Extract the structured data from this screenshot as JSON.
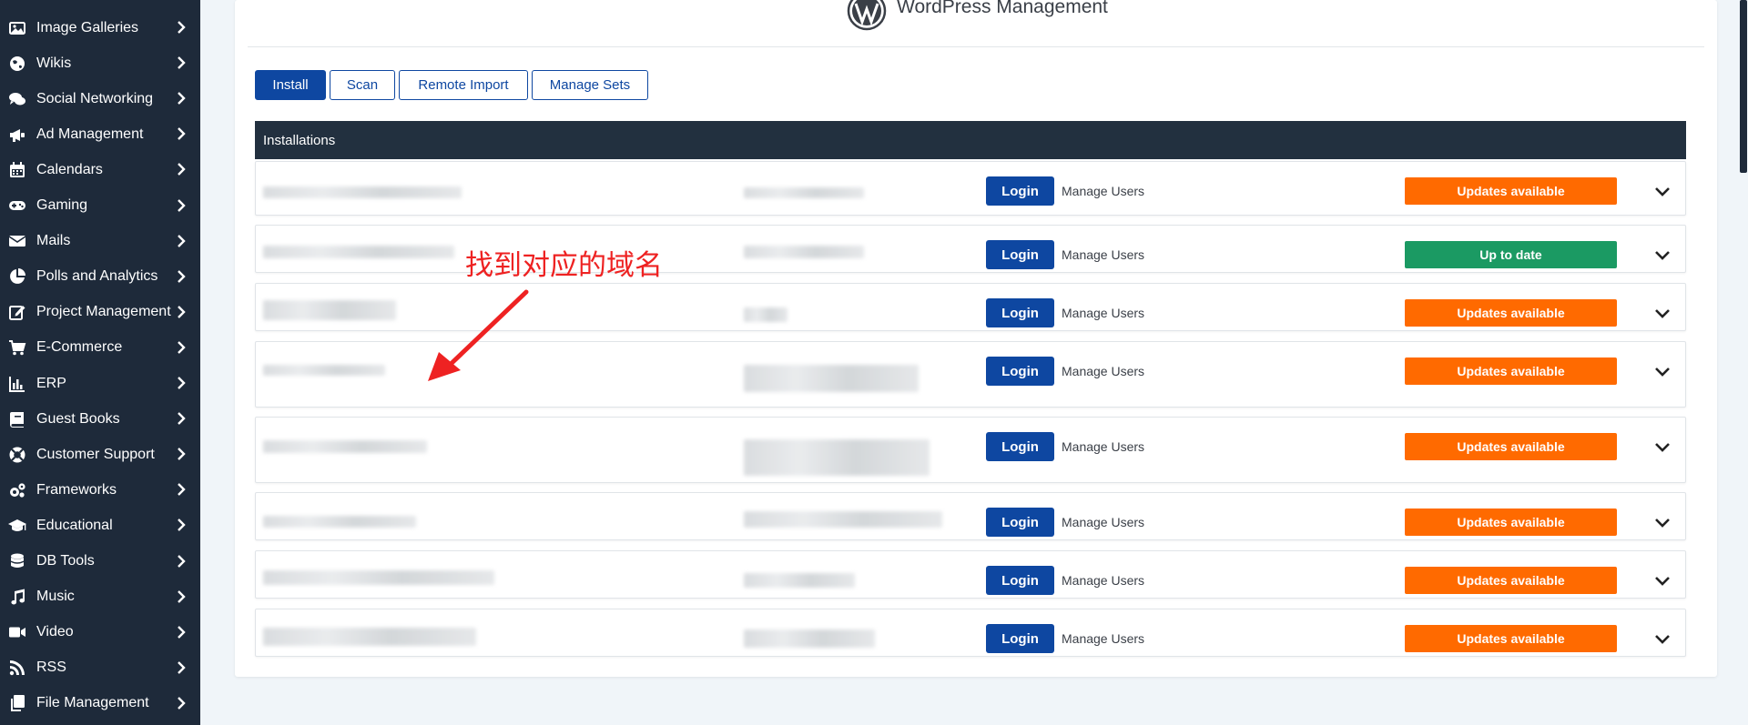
{
  "sidebar": {
    "items": [
      {
        "label": "Image Galleries",
        "icon": "image-icon"
      },
      {
        "label": "Wikis",
        "icon": "globe-icon"
      },
      {
        "label": "Social Networking",
        "icon": "chat-icon"
      },
      {
        "label": "Ad Management",
        "icon": "megaphone-icon"
      },
      {
        "label": "Calendars",
        "icon": "calendar-icon"
      },
      {
        "label": "Gaming",
        "icon": "gamepad-icon"
      },
      {
        "label": "Mails",
        "icon": "envelope-icon"
      },
      {
        "label": "Polls and Analytics",
        "icon": "pie-chart-icon"
      },
      {
        "label": "Project Management",
        "icon": "edit-icon"
      },
      {
        "label": "E-Commerce",
        "icon": "cart-icon"
      },
      {
        "label": "ERP",
        "icon": "bar-chart-icon"
      },
      {
        "label": "Guest Books",
        "icon": "book-icon"
      },
      {
        "label": "Customer Support",
        "icon": "lifebuoy-icon"
      },
      {
        "label": "Frameworks",
        "icon": "cogs-icon"
      },
      {
        "label": "Educational",
        "icon": "graduation-cap-icon"
      },
      {
        "label": "DB Tools",
        "icon": "database-icon"
      },
      {
        "label": "Music",
        "icon": "music-icon"
      },
      {
        "label": "Video",
        "icon": "video-icon"
      },
      {
        "label": "RSS",
        "icon": "rss-icon"
      },
      {
        "label": "File Management",
        "icon": "files-icon"
      }
    ]
  },
  "page": {
    "title": "WordPress Management"
  },
  "tabs": [
    {
      "label": "Install",
      "active": true
    },
    {
      "label": "Scan",
      "active": false
    },
    {
      "label": "Remote Import",
      "active": false
    },
    {
      "label": "Manage Sets",
      "active": false
    }
  ],
  "installations": {
    "header": "Installations",
    "rows": [
      {
        "login": "Login",
        "manage_users": "Manage Users",
        "status": "Updates available",
        "status_type": "warn"
      },
      {
        "login": "Login",
        "manage_users": "Manage Users",
        "status": "Up to date",
        "status_type": "ok"
      },
      {
        "login": "Login",
        "manage_users": "Manage Users",
        "status": "Updates available",
        "status_type": "warn"
      },
      {
        "login": "Login",
        "manage_users": "Manage Users",
        "status": "Updates available",
        "status_type": "warn"
      },
      {
        "login": "Login",
        "manage_users": "Manage Users",
        "status": "Updates available",
        "status_type": "warn"
      },
      {
        "login": "Login",
        "manage_users": "Manage Users",
        "status": "Updates available",
        "status_type": "warn"
      },
      {
        "login": "Login",
        "manage_users": "Manage Users",
        "status": "Updates available",
        "status_type": "warn"
      },
      {
        "login": "Login",
        "manage_users": "Manage Users",
        "status": "Updates available",
        "status_type": "warn"
      }
    ]
  },
  "annotation": {
    "text": "找到对应的域名"
  },
  "colors": {
    "sidebar_bg": "#1e2a3a",
    "primary": "#0e47a1",
    "warn": "#ff6a00",
    "ok": "#1b9a63",
    "annotation": "#ee2222"
  }
}
